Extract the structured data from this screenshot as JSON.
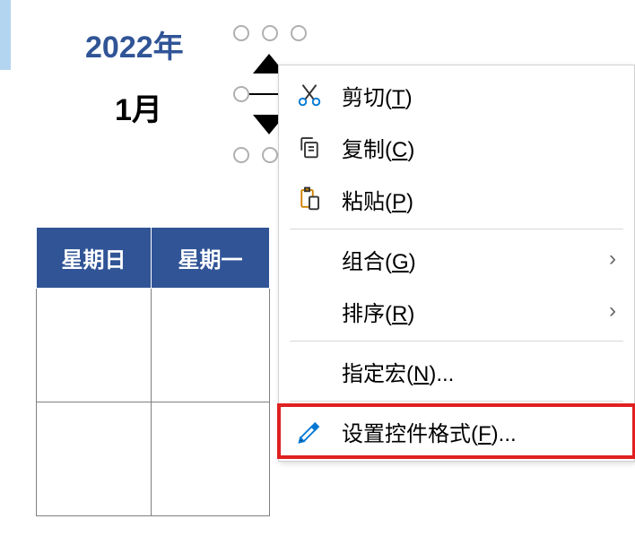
{
  "year_label": "2022年",
  "month_label": "1月",
  "calendar": {
    "headers": [
      "星期日",
      "星期一"
    ]
  },
  "context_menu": {
    "cut": {
      "label": "剪切(",
      "key": "T",
      "suffix": ")"
    },
    "copy": {
      "label": "复制(",
      "key": "C",
      "suffix": ")"
    },
    "paste": {
      "label": "粘贴(",
      "key": "P",
      "suffix": ")"
    },
    "group": {
      "label": "组合(",
      "key": "G",
      "suffix": ")"
    },
    "sort": {
      "label": "排序(",
      "key": "R",
      "suffix": ")"
    },
    "assign_macro": {
      "label": "指定宏(",
      "key": "N",
      "suffix": ")..."
    },
    "format_control": {
      "label": "设置控件格式(",
      "key": "F",
      "suffix": ")..."
    }
  }
}
